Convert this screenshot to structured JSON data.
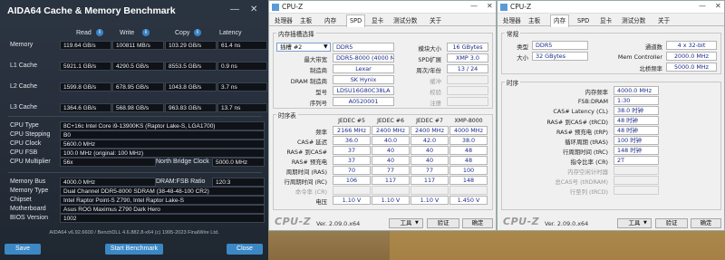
{
  "aida": {
    "title": "AIDA64 Cache & Memory Benchmark",
    "window_minimize": "—",
    "window_close": "✕",
    "columns": [
      "Read",
      "Write",
      "Copy",
      "Latency"
    ],
    "rows": [
      {
        "label": "Memory",
        "read": "119.64 GB/s",
        "write": "100811 MB/s",
        "copy": "103.29 GB/s",
        "latency": "61.4 ns"
      },
      {
        "label": "L1 Cache",
        "read": "5921.1 GB/s",
        "write": "4290.5 GB/s",
        "copy": "8553.5 GB/s",
        "latency": "0.9 ns"
      },
      {
        "label": "L2 Cache",
        "read": "1599.8 GB/s",
        "write": "678.95 GB/s",
        "copy": "1043.8 GB/s",
        "latency": "3.7 ns"
      },
      {
        "label": "L3 Cache",
        "read": "1364.6 GB/s",
        "write": "568.98 GB/s",
        "copy": "963.83 GB/s",
        "latency": "13.7 ns"
      }
    ],
    "cpu": [
      {
        "label": "CPU Type",
        "value": "8C+16c Intel Core i9-13900KS  (Raptor Lake-S, LGA1700)"
      },
      {
        "label": "CPU Stepping",
        "value": "B0"
      },
      {
        "label": "CPU Clock",
        "value": "5600.0 MHz"
      },
      {
        "label": "CPU FSB",
        "value": "100.0 MHz  (original: 100 MHz)"
      },
      {
        "label": "CPU Multiplier",
        "value": "56x"
      }
    ],
    "nb_clock_label": "North Bridge Clock",
    "nb_clock_value": "5000.0 MHz",
    "mem": [
      {
        "label": "Memory Bus",
        "value": "4000.0 MHz"
      },
      {
        "label": "Memory Type",
        "value": "Dual Channel DDR5-8000 SDRAM  (38-48-48-100 CR2)"
      },
      {
        "label": "Chipset",
        "value": "Intel Raptor Point-S Z790, Intel Raptor Lake-S"
      },
      {
        "label": "Motherboard",
        "value": "Asus ROG Maximus Z790 Dark Hero"
      },
      {
        "label": "BIOS Version",
        "value": "1002"
      }
    ],
    "dram_fsb_label": "DRAM:FSB Ratio",
    "dram_fsb_value": "120:3",
    "footer": "AIDA64 v6.92.6600 / BenchDLL 4.6.882.8-x64  (c) 1995-2023 FinalWire Ltd.",
    "save": "Save",
    "start": "Start Benchmark",
    "close": "Close"
  },
  "cpuz1": {
    "title": "CPU-Z",
    "tabs": [
      "处理器",
      "主板",
      "内存",
      "SPD",
      "显卡",
      "测试分数",
      "关于"
    ],
    "active_tab": "SPD",
    "slot_group": "内存插槽选择",
    "slot": "插槽 #2",
    "module_type": "DDR5",
    "module_size_label": "模块大小",
    "module_size": "16 GBytes",
    "max_bw_label": "最大带宽",
    "max_bw": "DDR5-8000 (4000 MHz)",
    "spd_ext_label": "SPD扩展",
    "spd_ext": "XMP 3.0",
    "mfr_label": "制造商",
    "mfr": "Lexar",
    "week_label": "周次/年份",
    "week": "13 / 24",
    "dram_mfr_label": "DRAM 制造商",
    "dram_mfr": "SK Hynix",
    "buffered_label": "缓冲",
    "part_label": "型号",
    "part": "LDSU16G80C38LA",
    "check_label": "校验",
    "serial_label": "序列号",
    "serial": "A0520001",
    "registered_label": "注册",
    "timing_group": "时序表",
    "timing_cols": [
      "JEDEC #5",
      "JEDEC #6",
      "JEDEC #7",
      "XMP-8000"
    ],
    "timing_rows": [
      {
        "label": "频率",
        "vals": [
          "2166 MHz",
          "2400 MHz",
          "2400 MHz",
          "4000 MHz"
        ]
      },
      {
        "label": "CAS# 延迟",
        "vals": [
          "36.0",
          "40.0",
          "42.0",
          "38.0"
        ]
      },
      {
        "label": "RAS# 到CAS#",
        "vals": [
          "37",
          "40",
          "40",
          "48"
        ]
      },
      {
        "label": "RAS# 预充电",
        "vals": [
          "37",
          "40",
          "40",
          "48"
        ]
      },
      {
        "label": "周期时间 (RAS)",
        "vals": [
          "70",
          "77",
          "77",
          "100"
        ]
      },
      {
        "label": "行周期时间 (RC)",
        "vals": [
          "106",
          "117",
          "117",
          "148"
        ]
      },
      {
        "label": "命令率 (CR)",
        "vals": [
          "",
          "",
          "",
          ""
        ]
      },
      {
        "label": "电压",
        "vals": [
          "1.10 V",
          "1.10 V",
          "1.10 V",
          "1.450 V"
        ]
      }
    ],
    "brand": "CPU-Z",
    "version": "Ver. 2.09.0.x64",
    "tools": "工具",
    "validate": "验证",
    "ok": "确定"
  },
  "cpuz2": {
    "title": "CPU-Z",
    "tabs": [
      "处理器",
      "主板",
      "内存",
      "SPD",
      "显卡",
      "测试分数",
      "关于"
    ],
    "active_tab": "内存",
    "general_group": "常规",
    "type_label": "类型",
    "type": "DDR5",
    "channels_label": "通道数",
    "channels": "4 x 32-bit",
    "size_label": "大小",
    "size": "32 GBytes",
    "mem_ctrl_label": "Mem Controller",
    "mem_ctrl": "2000.0 MHz",
    "nb_freq_label": "北桥频率",
    "nb_freq": "5000.0 MHz",
    "timing_group": "时序",
    "rows": [
      {
        "label": "内存频率",
        "value": "4000.0 MHz",
        "dim": false
      },
      {
        "label": "FSB:DRAM",
        "value": "1:30",
        "dim": false
      },
      {
        "label": "CAS# Latency (CL)",
        "value": "38.0 时钟",
        "dim": false
      },
      {
        "label": "RAS# 到CAS# (tRCD)",
        "value": "48 时钟",
        "dim": false
      },
      {
        "label": "RAS# 预充电 (tRP)",
        "value": "48 时钟",
        "dim": false
      },
      {
        "label": "循环周期 (tRAS)",
        "value": "100 时钟",
        "dim": false
      },
      {
        "label": "行周期时间 (tRC)",
        "value": "148 时钟",
        "dim": false
      },
      {
        "label": "指令比率 (CR)",
        "value": "2T",
        "dim": false
      },
      {
        "label": "内存空闲计时器",
        "value": "",
        "dim": true
      },
      {
        "label": "总CAS号 (tRDRAM)",
        "value": "",
        "dim": true
      },
      {
        "label": "行至列 (tRCD)",
        "value": "",
        "dim": true
      }
    ],
    "brand": "CPU-Z",
    "version": "Ver. 2.09.0.x64",
    "tools": "工具",
    "validate": "验证",
    "ok": "确定"
  }
}
